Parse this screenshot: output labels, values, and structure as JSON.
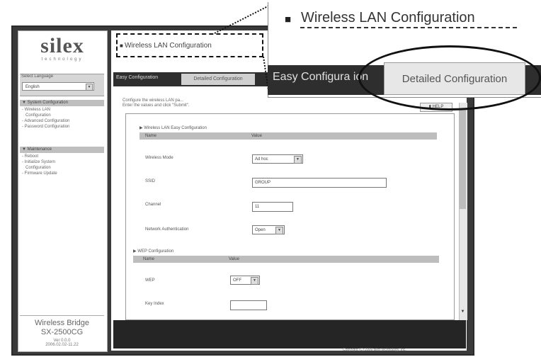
{
  "zoom": {
    "title": "Wireless LAN Configuration",
    "tab_easy": "Easy Configura ion",
    "tab_detailed": "Detailed Configuration"
  },
  "sidebar": {
    "brand": "silex",
    "brand_sub": "technology",
    "language_title": "Select Language",
    "language_value": "English",
    "system_config_head": "▼ System Configuration",
    "system_items": [
      "- Wireless LAN",
      "  Configuration",
      "- Advanced Configuration",
      "- Password Configuration"
    ],
    "maintenance_head": "▼ Maintenance",
    "maintenance_items": [
      "- Reboot",
      "- Initialize System",
      "  Configuration",
      "- Firmware Update"
    ],
    "bridge_name": "Wireless Bridge",
    "bridge_model": "SX-2500CG",
    "version": "Ver 0.0.0",
    "date": "2006.02.02-11.22"
  },
  "main": {
    "title": "Wireless LAN Configuration",
    "tab_easy": "Easy Configuration",
    "tab_detailed": "Detailed Configuration",
    "instruction1": "Configure the wireless LAN pa...",
    "instruction2": "Enter the values and click \"Submit\".",
    "help": "HELP",
    "section1_title": "▶ Wireless LAN Easy Configuration",
    "col_name": "Name",
    "col_value": "Value",
    "rows1": [
      {
        "label": "Wireless Mode",
        "value": "Ad hoc"
      },
      {
        "label": "SSID",
        "value": "GROUP"
      },
      {
        "label": "Channel",
        "value": "11"
      },
      {
        "label": "Network Authentication",
        "value": "Open"
      }
    ],
    "section2_title": "▶ WEP Configuration",
    "rows2": [
      {
        "label": "WEP",
        "value": "OFF"
      },
      {
        "label": "Key Index",
        "value": ""
      }
    ],
    "copyright": "Copyright (C) 2006 silex technology, Inc."
  }
}
